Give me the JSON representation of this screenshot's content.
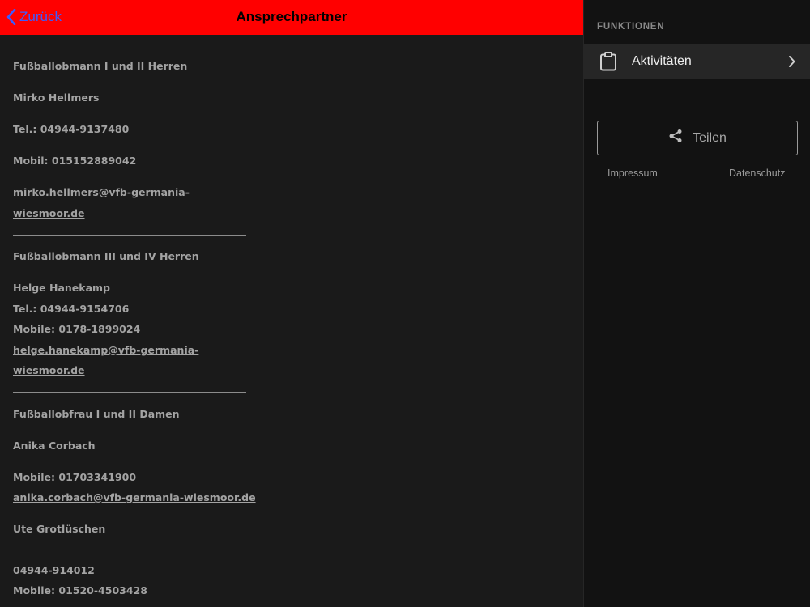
{
  "header": {
    "back_label": "Zurück",
    "title": "Ansprechpartner",
    "bar_color": "#ff0000",
    "back_color": "#3d5cff"
  },
  "contacts": {
    "c1": {
      "role": "Fußballobmann I und II Herren",
      "name": "Mirko Hellmers",
      "tel": "Tel.: 04944-9137480",
      "mobile": "Mobil: 015152889042",
      "email_line1": "mirko.hellmers@vfb-germania-",
      "email_line2": "wiesmoor.de"
    },
    "c2": {
      "role": "Fußballobmann III und IV Herren",
      "name": "Helge Hanekamp",
      "tel": "Tel.: 04944-9154706",
      "mobile": "Mobile: 0178-1899024",
      "email_line1": "helge.hanekamp@vfb-germania-",
      "email_line2": "wiesmoor.de"
    },
    "c3": {
      "role": "Fußballobfrau I und II Damen",
      "name": "Anika Corbach",
      "mobile": "Mobile: 01703341900",
      "email": "anika.corbach@vfb-germania-wiesmoor.de"
    },
    "c4": {
      "name": "Ute Grotlüschen",
      "phone": "04944-914012",
      "mobile": "Mobile: 01520-4503428"
    }
  },
  "sidebar": {
    "section_title": "FUNKTIONEN",
    "activities_label": "Aktivitäten",
    "activities_icon": "clipboard-icon",
    "share_label": "Teilen",
    "share_icon": "share-icon",
    "impressum": "Impressum",
    "datenschutz": "Datenschutz"
  }
}
